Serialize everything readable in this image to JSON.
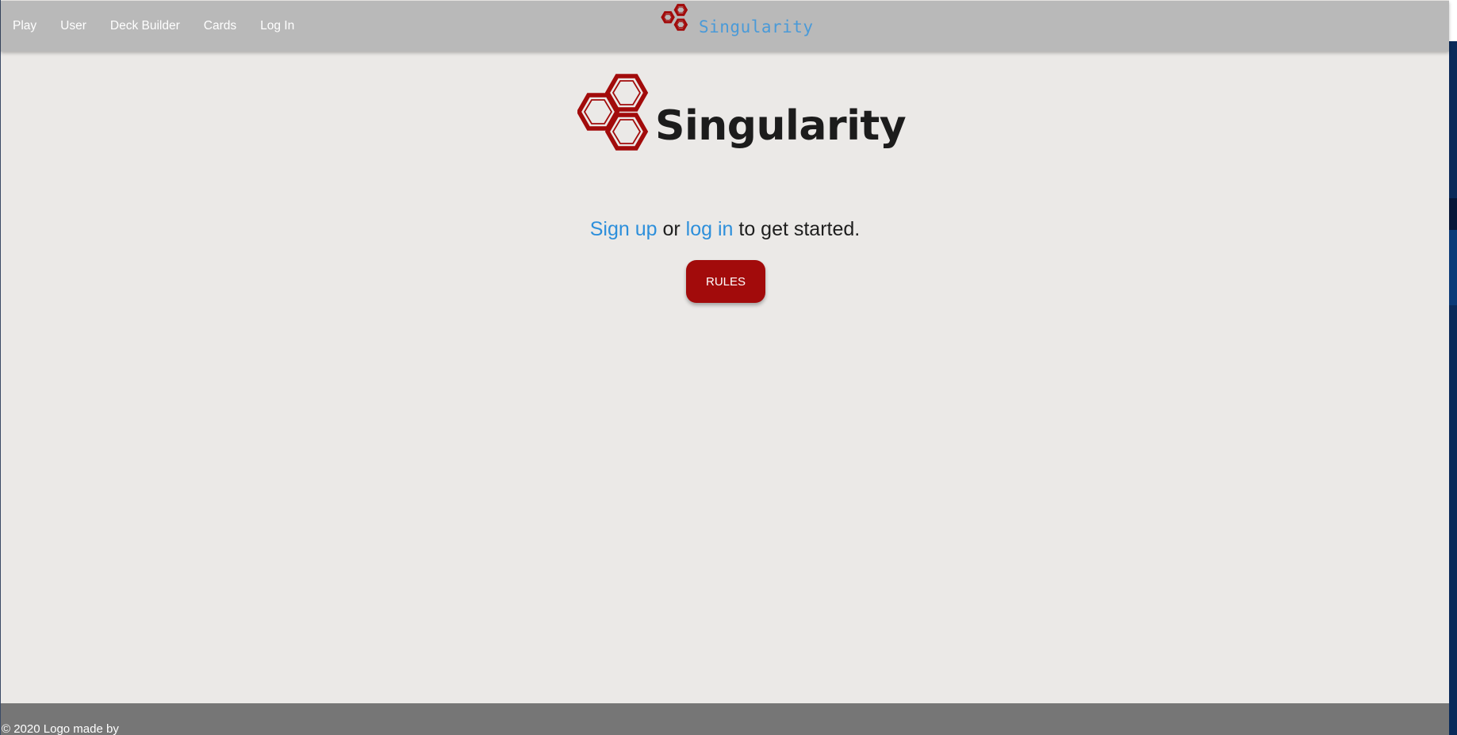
{
  "navbar": {
    "items": [
      {
        "label": "Play"
      },
      {
        "label": "User"
      },
      {
        "label": "Deck Builder"
      },
      {
        "label": "Cards"
      },
      {
        "label": "Log In"
      }
    ],
    "logo_text": "Singularity"
  },
  "hero": {
    "title": "Singularity",
    "logo_icon": "hexagon-cluster-icon"
  },
  "tagline": {
    "sign_up": "Sign up",
    "or": " or ",
    "log_in": "log in",
    "rest": " to get started."
  },
  "rules_button": {
    "label": "RULES"
  },
  "footer": {
    "text": "© 2020 Logo made by"
  },
  "colors": {
    "brand_red": "#a20b0b",
    "link_blue": "#2d8fdb",
    "navbar_bg": "#b9b9b9",
    "page_bg": "#ebe9e7",
    "footer_bg": "#767676"
  }
}
